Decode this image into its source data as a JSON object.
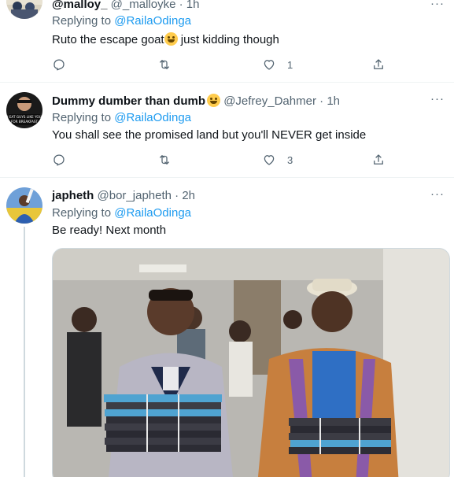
{
  "tweets": [
    {
      "name": "@malloy_",
      "handle": "@_malloyke",
      "time": "1h",
      "sep": "·",
      "replying_prefix": "Replying to",
      "mention": "@RailaOdinga",
      "text": "Ruto the escape goat",
      "text_after_emoji": "just kidding though",
      "emoji": "grinning-face",
      "counts": {
        "reply": "",
        "retweet": "",
        "like": "1",
        "share": ""
      }
    },
    {
      "name": "Dummy dumber than dumb",
      "handle": "@Jefrey_Dahmer",
      "time": "1h",
      "sep": "·",
      "replying_prefix": "Replying to",
      "mention": "@RailaOdinga",
      "text": "You shall see the promised land but you'll NEVER get inside",
      "emoji": "zany-face",
      "avatar_text": "I EAT GUYS LIKE YOU FOR BREAKFAST",
      "counts": {
        "reply": "",
        "retweet": "",
        "like": "3",
        "share": ""
      }
    },
    {
      "name": "japheth",
      "handle": "@bor_japheth",
      "time": "2h",
      "sep": "·",
      "replying_prefix": "Replying to",
      "mention": "@RailaOdinga",
      "text": "Be ready! Next month",
      "media": "photo-two-men-carrying-stacked-files"
    }
  ],
  "more_label": "···",
  "colors": {
    "accent": "#1d9bf0",
    "muted": "#536471",
    "text": "#0f1419",
    "divider": "#eff3f4"
  }
}
